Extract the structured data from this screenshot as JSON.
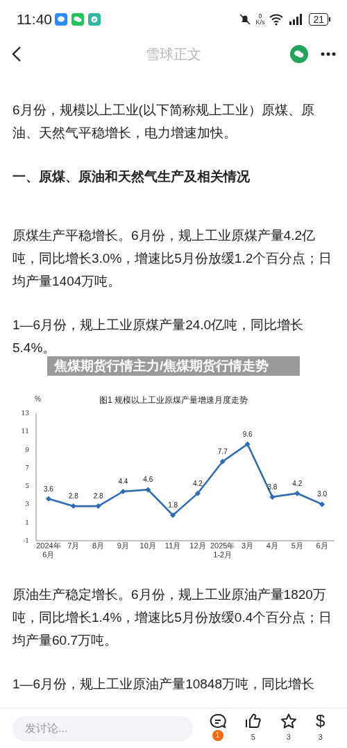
{
  "status_bar": {
    "time": "11:40",
    "net_speed_value": "0",
    "net_speed_unit": "K/s",
    "battery": "21"
  },
  "header": {
    "title": "雪球正文"
  },
  "article": [
    {
      "kind": "paragraph",
      "text": "6月份，规模以上工业(以下简称规上工业）原煤、原油、天然气平稳增长，电力增速加快。"
    },
    {
      "kind": "heading",
      "text": "一、原煤、原油和天然气生产及相关情况"
    },
    {
      "kind": "paragraph",
      "text": "原煤生产平稳增长。6月份，规上工业原煤产量4.2亿吨，同比增长3.0%，增速比5月份放缓1.2个百分点；日均产量1404万吨。"
    },
    {
      "kind": "paragraph",
      "text": "1—6月份，规上工业原煤产量24.0亿吨，同比增长5.4%。"
    },
    {
      "kind": "chart",
      "banner": "焦煤期货行情主力/焦煤期货行情走势",
      "chart_data": {
        "type": "line",
        "title": "图1  规模以上工业原煤产量增速月度走势",
        "ylabel": "%",
        "categories": [
          "2024年6月",
          "7月",
          "8月",
          "9月",
          "10月",
          "11月",
          "12月",
          "2025年1-2月",
          "3月",
          "4月",
          "5月",
          "6月"
        ],
        "series": [
          {
            "color": "#2e6db4",
            "marker": "diamond",
            "values": [
              3.6,
              2.8,
              2.8,
              4.4,
              4.6,
              1.8,
              4.2,
              7.7,
              9.6,
              3.8,
              4.2,
              3.0
            ]
          }
        ],
        "ylim": [
          -1,
          13
        ],
        "yticks": [
          -1,
          1,
          3,
          5,
          7,
          9,
          11,
          13
        ],
        "value_labels": [
          "3.6",
          "2.8",
          "2.8",
          "4.4",
          "4.6",
          "1.8",
          "4.2",
          "7.7",
          "9.6",
          "3.8",
          "4.2",
          "3.0"
        ]
      }
    },
    {
      "kind": "paragraph",
      "text": "原油生产稳定增长。6月份，规上工业原油产量1820万吨，同比增长1.4%，增速比5月份放缓0.4个百分点；日均产量60.7万吨。"
    },
    {
      "kind": "paragraph",
      "text": "1—6月份，规上工业原油产量10848万吨，同比增长"
    }
  ],
  "bottom_bar": {
    "comment_placeholder": "发讨论...",
    "comments_badge": "1",
    "likes": "5",
    "favorites": "3",
    "reward_symbol": "$",
    "rewards": "3"
  }
}
